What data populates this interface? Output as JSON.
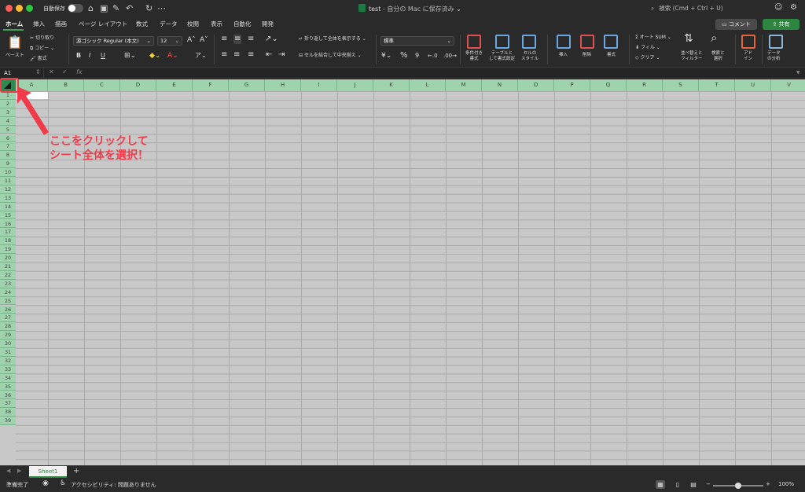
{
  "titlebar": {
    "autosave_label": "自動保存",
    "doc_name": "test",
    "doc_status": " - 自分の Mac に保存済み",
    "search_placeholder": "検索 (Cmd + Ctrl + U)"
  },
  "tabs": [
    "ホーム",
    "挿入",
    "描画",
    "ページ レイアウト",
    "数式",
    "データ",
    "校閲",
    "表示",
    "自動化",
    "開発"
  ],
  "comment_label": "コメント",
  "share_label": "共有",
  "ribbon": {
    "paste": "ペースト",
    "cut": "切り取り",
    "copy": "コピー",
    "format_painter": "書式",
    "font_name": "游ゴシック Regular (本文)",
    "font_size": "12",
    "bold": "B",
    "italic": "I",
    "underline": "U",
    "wrap_text": "折り返して全体を表示する",
    "merge_center": "セルを結合して中央揃え",
    "number_format": "標準",
    "percent": "%",
    "comma": "9",
    "cond_format": [
      "条件付き",
      "書式"
    ],
    "table_format": [
      "テーブルと",
      "して書式設定"
    ],
    "cell_style": [
      "セルの",
      "スタイル"
    ],
    "insert": "挿入",
    "delete": "削除",
    "format": "書式",
    "autosum": "オート SUM",
    "fill": "フィル",
    "clear": "クリア",
    "sort_filter": [
      "並べ替えと",
      "フィルター"
    ],
    "find_select": [
      "検索と",
      "選択"
    ],
    "addins": [
      "アド",
      "イン"
    ],
    "analyze": [
      "データ",
      "の分析"
    ]
  },
  "formula_bar": {
    "name_box": "A1",
    "fx": "fx"
  },
  "columns": [
    "A",
    "B",
    "C",
    "D",
    "E",
    "F",
    "G",
    "H",
    "I",
    "J",
    "K",
    "L",
    "M",
    "N",
    "O",
    "P",
    "Q",
    "R",
    "S",
    "T",
    "U",
    "V"
  ],
  "rows": [
    "1",
    "2",
    "3",
    "4",
    "5",
    "6",
    "7",
    "8",
    "9",
    "10",
    "11",
    "12",
    "13",
    "14",
    "15",
    "16",
    "17",
    "18",
    "19",
    "20",
    "21",
    "22",
    "23",
    "24",
    "25",
    "26",
    "27",
    "28",
    "29",
    "30",
    "31",
    "32",
    "33",
    "34",
    "35",
    "36",
    "37",
    "38",
    "39"
  ],
  "annotation": {
    "line1": "ここをクリックして",
    "line2": "シート全体を選択！"
  },
  "sheet_tab": "Sheet1",
  "statusbar": {
    "ready": "準備完了",
    "accessibility": "アクセシビリティ: 問題ありません",
    "zoom": "100%",
    "zoom_fraction": 0.5
  },
  "colors": {
    "accent": "#2e8540",
    "header_green": "#9fd3ad",
    "annotation_red": "#f03c4a"
  }
}
